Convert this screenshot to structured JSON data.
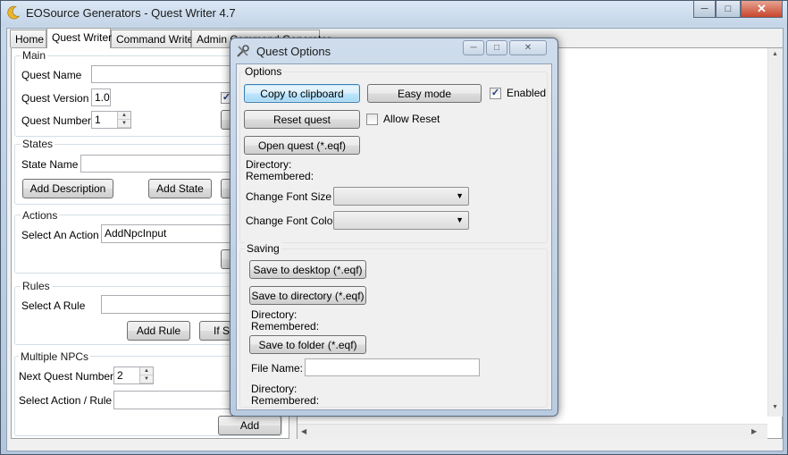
{
  "window": {
    "title": "EOSource Generators - Quest Writer 4.7"
  },
  "tabs": [
    "Home",
    "Quest Writer",
    "Command Writer",
    "Admin Command Generator"
  ],
  "main": {
    "group_title": "Main",
    "quest_name_label": "Quest Name",
    "quest_name_value": "",
    "quest_version_label": "Quest Version",
    "quest_version_value": "1.0",
    "quest_number_label": "Quest Number",
    "quest_number_value": "1"
  },
  "states": {
    "group_title": "States",
    "state_name_label": "State Name",
    "state_name_value": "",
    "add_description_button": "Add Description",
    "add_state_button": "Add State"
  },
  "actions": {
    "group_title": "Actions",
    "select_action_label": "Select An Action",
    "select_action_value": "AddNpcInput"
  },
  "rules": {
    "group_title": "Rules",
    "select_rule_label": "Select A Rule",
    "select_rule_value": "",
    "add_rule_button": "Add Rule",
    "if_state_button_partial": "If St"
  },
  "multiple_npcs": {
    "group_title": "Multiple NPCs",
    "next_quest_number_label": "Next Quest Number",
    "next_quest_number_value": "2",
    "select_action_rule_label": "Select Action / Rule",
    "select_action_rule_value": "",
    "add_button": "Add"
  },
  "dialog": {
    "title": "Quest Options",
    "options": {
      "group_title": "Options",
      "copy_to_clipboard_button": "Copy to clipboard",
      "easy_mode_button": "Easy mode",
      "enabled_label": "Enabled",
      "enabled_checked": true,
      "reset_quest_button": "Reset quest",
      "allow_reset_label": "Allow Reset",
      "allow_reset_checked": false,
      "open_quest_button": "Open quest (*.eqf)",
      "directory_label": "Directory:",
      "remembered_label": "Remembered:",
      "change_font_size_label": "Change Font Size",
      "change_font_color_label": "Change Font Color"
    },
    "saving": {
      "group_title": "Saving",
      "save_to_desktop_button": "Save to desktop (*.eqf)",
      "save_to_directory_button": "Save to directory (*.eqf)",
      "directory_label": "Directory:",
      "remembered_label": "Remembered:",
      "save_to_folder_button": "Save to folder (*.eqf)",
      "file_name_label": "File Name:",
      "file_name_value": "",
      "directory_label_2": "Directory:",
      "remembered_label_2": "Remembered:"
    }
  },
  "colors": {
    "accent": "#3c7fb1",
    "titlebar": "#c4d5e8",
    "checkmark": "#1c3b78"
  }
}
